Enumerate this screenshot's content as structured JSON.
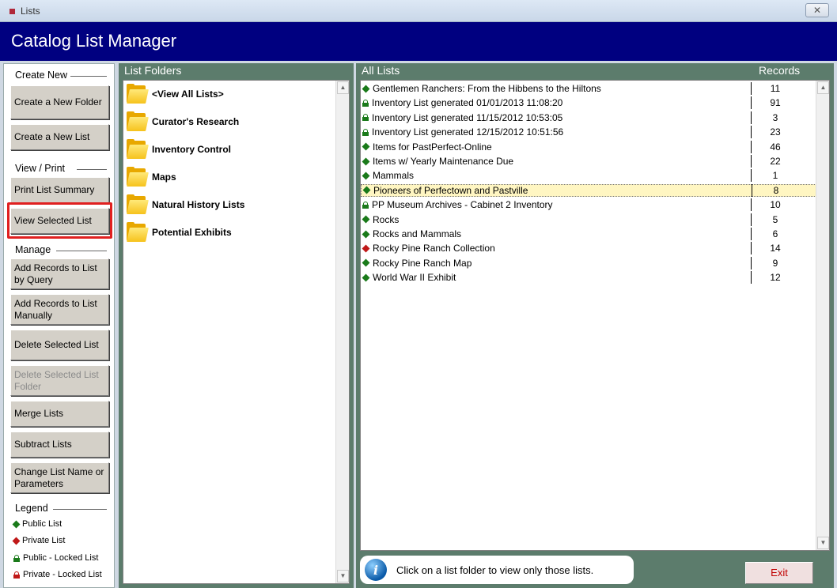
{
  "window": {
    "title": "Lists",
    "close_glyph": "✕"
  },
  "header": {
    "title": "Catalog List Manager"
  },
  "sidebar": {
    "sections": {
      "create": "Create New",
      "view": "View / Print",
      "manage": "Manage",
      "legend": "Legend"
    },
    "buttons": [
      {
        "label": "Create a New Folder",
        "enabled": true
      },
      {
        "label": "Create a New List",
        "enabled": true
      },
      {
        "label": "Print List Summary",
        "enabled": true
      },
      {
        "label": "View Selected List",
        "enabled": true,
        "highlighted": true
      },
      {
        "label": "Add Records to List by Query",
        "enabled": true
      },
      {
        "label": "Add Records to List Manually",
        "enabled": true
      },
      {
        "label": "Delete Selected List",
        "enabled": true
      },
      {
        "label": "Delete Selected List Folder",
        "enabled": false
      },
      {
        "label": "Merge Lists",
        "enabled": true
      },
      {
        "label": "Subtract Lists",
        "enabled": true
      },
      {
        "label": "Change List Name or Parameters",
        "enabled": true
      }
    ],
    "legend": [
      {
        "label": "Public List",
        "icon": "green-diamond-icon",
        "color": "#1a7a1a"
      },
      {
        "label": "Private List",
        "icon": "red-diamond-icon",
        "color": "#c01818"
      },
      {
        "label": "Public - Locked List",
        "icon": "green-lock-icon",
        "color": "#1a7a1a"
      },
      {
        "label": "Private - Locked List",
        "icon": "red-lock-icon",
        "color": "#c01818"
      }
    ]
  },
  "folders": {
    "title": "List Folders",
    "items": [
      "<View All Lists>",
      "Curator's Research",
      "Inventory Control",
      "Maps",
      "Natural History Lists",
      "Potential Exhibits"
    ]
  },
  "lists": {
    "title": "All Lists",
    "records_header": "Records",
    "rows": [
      {
        "name": "Gentlemen Ranchers: From the Hibbens to the Hiltons",
        "records": "11",
        "type": "public"
      },
      {
        "name": "Inventory List generated 01/01/2013 11:08:20",
        "records": "91",
        "type": "public-locked"
      },
      {
        "name": "Inventory List generated 11/15/2012 10:53:05",
        "records": "3",
        "type": "public-locked"
      },
      {
        "name": "Inventory List generated 12/15/2012 10:51:56",
        "records": "23",
        "type": "public-locked"
      },
      {
        "name": "Items for PastPerfect-Online",
        "records": "46",
        "type": "public"
      },
      {
        "name": "Items w/ Yearly Maintenance Due",
        "records": "22",
        "type": "public"
      },
      {
        "name": "Mammals",
        "records": "1",
        "type": "public"
      },
      {
        "name": "Pioneers of Perfectown and Pastville",
        "records": "8",
        "type": "public",
        "selected": true
      },
      {
        "name": "PP Museum Archives - Cabinet 2 Inventory",
        "records": "10",
        "type": "public-locked"
      },
      {
        "name": "Rocks",
        "records": "5",
        "type": "public"
      },
      {
        "name": "Rocks and Mammals",
        "records": "6",
        "type": "public"
      },
      {
        "name": "Rocky Pine Ranch Collection",
        "records": "14",
        "type": "private"
      },
      {
        "name": "Rocky Pine Ranch Map",
        "records": "9",
        "type": "public"
      },
      {
        "name": "World War II Exhibit",
        "records": "12",
        "type": "public"
      }
    ]
  },
  "status": {
    "message": "Click on a list folder to view only those lists.",
    "info_glyph": "i"
  },
  "exit_label": "Exit",
  "colors": {
    "header": "#000080",
    "panel": "#5c7c6c",
    "public": "#1a7a1a",
    "private": "#c01818",
    "selection": "#fff6c2"
  }
}
